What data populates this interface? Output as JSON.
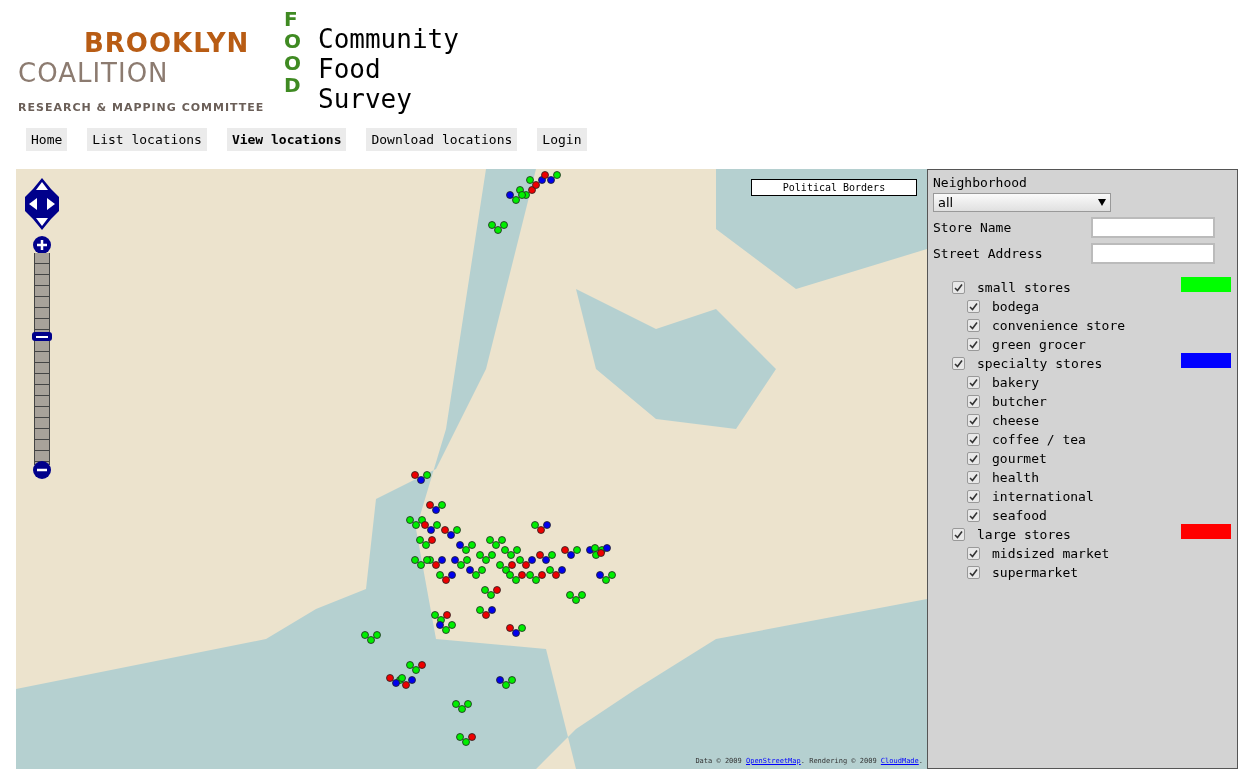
{
  "logo": {
    "line_1": "BROOKLYN",
    "line_2": "COALITION",
    "vertical": "FOOD",
    "subtitle": "RESEARCH & MAPPING COMMITTEE"
  },
  "title_lines": [
    "Community",
    "Food",
    "Survey"
  ],
  "nav": [
    {
      "label": "Home",
      "selected": false
    },
    {
      "label": "List locations",
      "selected": false
    },
    {
      "label": "View locations",
      "selected": true
    },
    {
      "label": "Download locations",
      "selected": false
    },
    {
      "label": "Login",
      "selected": false
    }
  ],
  "map": {
    "layer_button": "Political Borders",
    "attribution": {
      "prefix": "Data © 2009 ",
      "link_1": "OpenStreetMap",
      "middle": ". Rendering © 2009 ",
      "link_2": "CloudMade",
      "suffix": "."
    }
  },
  "filters": {
    "neighborhood": {
      "label": "Neighborhood",
      "value": "all"
    },
    "fields": [
      {
        "label": "Store Name"
      },
      {
        "label": "Street Address"
      }
    ],
    "groups": [
      {
        "label": "small stores",
        "checked": true,
        "color": "#00ff00",
        "children": [
          {
            "label": "bodega",
            "checked": true
          },
          {
            "label": "convenience store",
            "checked": true
          },
          {
            "label": "green grocer",
            "checked": true
          }
        ]
      },
      {
        "label": "specialty stores",
        "checked": true,
        "color": "#0000ff",
        "children": [
          {
            "label": "bakery",
            "checked": true
          },
          {
            "label": "butcher",
            "checked": true
          },
          {
            "label": "cheese",
            "checked": true
          },
          {
            "label": "coffee / tea",
            "checked": true
          },
          {
            "label": "gourmet",
            "checked": true
          },
          {
            "label": "health",
            "checked": true
          },
          {
            "label": "international",
            "checked": true
          },
          {
            "label": "seafood",
            "checked": true
          }
        ]
      },
      {
        "label": "large stores",
        "checked": true,
        "color": "#ff0000",
        "children": [
          {
            "label": "midsized market",
            "checked": true
          },
          {
            "label": "supermarket",
            "checked": true
          }
        ]
      }
    ]
  }
}
